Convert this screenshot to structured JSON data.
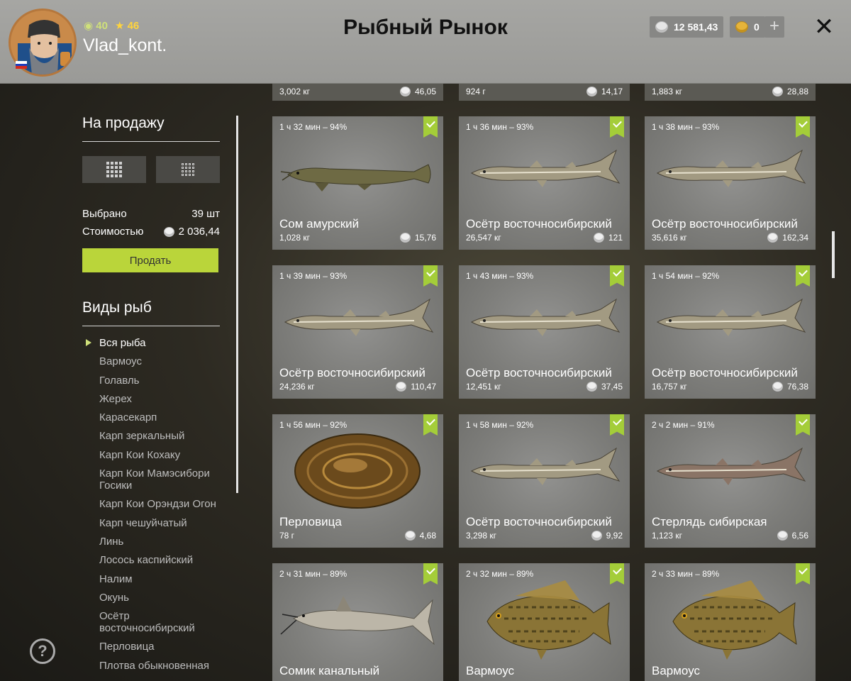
{
  "header": {
    "title": "Рыбный Рынок",
    "xp": "40",
    "stars": "46",
    "username": "Vlad_kont.",
    "silver": "12 581,43",
    "gold": "0",
    "plus_label": "+",
    "close_label": "✕"
  },
  "sidebar": {
    "for_sale_title": "На продажу",
    "selected_label": "Выбрано",
    "selected_value": "39 шт",
    "cost_label": "Стоимостью",
    "cost_value": "2 036,44",
    "sell_label": "Продать",
    "fish_types_title": "Виды рыб",
    "fish_types": [
      "Вся рыба",
      "Вармоус",
      "Голавль",
      "Жерех",
      "Карасекарп",
      "Карп зеркальный",
      "Карп Кои Кохаку",
      "Карп Кои Мамэсибори Госики",
      "Карп Кои Орэндзи Огон",
      "Карп чешуйчатый",
      "Линь",
      "Лосось каспийский",
      "Налим",
      "Окунь",
      "Осётр восточносибирский",
      "Перловица",
      "Плотва обыкновенная"
    ],
    "help_label": "?"
  },
  "top_strip": [
    {
      "weight": "3,002 кг",
      "price": "46,05"
    },
    {
      "weight": "924 г",
      "price": "14,17"
    },
    {
      "weight": "1,883 кг",
      "price": "28,88"
    }
  ],
  "cards": [
    {
      "time": "1 ч 32 мин – 94%",
      "name": "Сом амурский",
      "weight": "1,028 кг",
      "price": "15,76",
      "kind": "som"
    },
    {
      "time": "1 ч 36 мин – 93%",
      "name": "Осётр восточносибирский",
      "weight": "26,547 кг",
      "price": "121",
      "kind": "sturgeon"
    },
    {
      "time": "1 ч 38 мин – 93%",
      "name": "Осётр восточносибирский",
      "weight": "35,616 кг",
      "price": "162,34",
      "kind": "sturgeon"
    },
    {
      "time": "1 ч 39 мин – 93%",
      "name": "Осётр восточносибирский",
      "weight": "24,236 кг",
      "price": "110,47",
      "kind": "sturgeon"
    },
    {
      "time": "1 ч 43 мин – 93%",
      "name": "Осётр восточносибирский",
      "weight": "12,451 кг",
      "price": "37,45",
      "kind": "sturgeon"
    },
    {
      "time": "1 ч 54 мин – 92%",
      "name": "Осётр восточносибирский",
      "weight": "16,757 кг",
      "price": "76,38",
      "kind": "sturgeon"
    },
    {
      "time": "1 ч 56 мин – 92%",
      "name": "Перловица",
      "weight": "78 г",
      "price": "4,68",
      "kind": "mussel"
    },
    {
      "time": "1 ч 58 мин – 92%",
      "name": "Осётр восточносибирский",
      "weight": "3,298 кг",
      "price": "9,92",
      "kind": "sturgeon"
    },
    {
      "time": "2 ч 2 мин – 91%",
      "name": "Стерлядь сибирская",
      "weight": "1,123 кг",
      "price": "6,56",
      "kind": "sterlet"
    },
    {
      "time": "2 ч 31 мин – 89%",
      "name": "Сомик канальный",
      "weight": "",
      "price": "",
      "kind": "catfish"
    },
    {
      "time": "2 ч 32 мин – 89%",
      "name": "Вармоус",
      "weight": "",
      "price": "",
      "kind": "bass"
    },
    {
      "time": "2 ч 33 мин – 89%",
      "name": "Вармоус",
      "weight": "",
      "price": "",
      "kind": "bass"
    }
  ]
}
